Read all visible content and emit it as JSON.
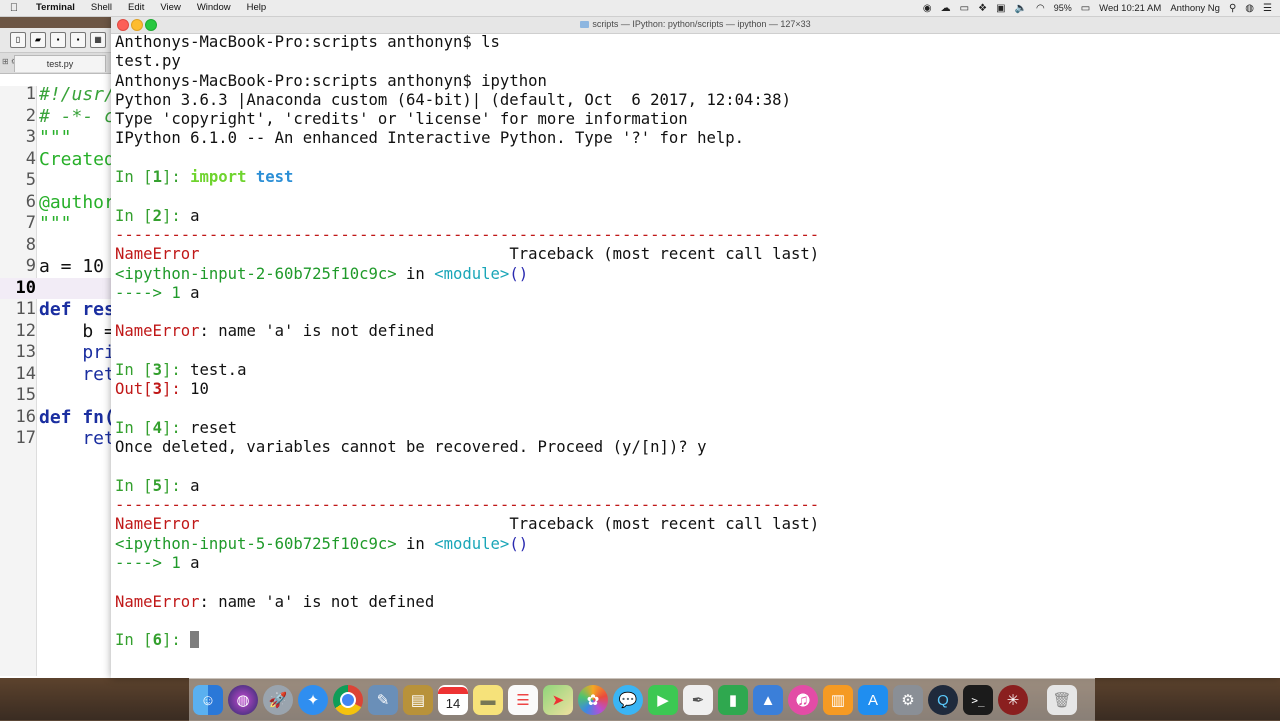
{
  "menubar": {
    "items": [
      "Terminal",
      "Shell",
      "Edit",
      "View",
      "Window",
      "Help"
    ],
    "battery": "95%",
    "clock": "Wed 10:21 AM",
    "user": "Anthony Ng"
  },
  "editor": {
    "tab_label": "test.py",
    "lines": [
      {
        "n": "1",
        "text": "#!/usr/"
      },
      {
        "n": "2",
        "text": "# -*- c"
      },
      {
        "n": "3",
        "text": "\"\"\""
      },
      {
        "n": "4",
        "text": "Created"
      },
      {
        "n": "5",
        "text": ""
      },
      {
        "n": "6",
        "text": "@author"
      },
      {
        "n": "7",
        "text": "\"\"\""
      },
      {
        "n": "8",
        "text": ""
      },
      {
        "n": "9",
        "text": "a = 10"
      },
      {
        "n": "10",
        "text": ""
      },
      {
        "n": "11",
        "text": "def res"
      },
      {
        "n": "12",
        "text": "    b ="
      },
      {
        "n": "13",
        "text": "    pri"
      },
      {
        "n": "14",
        "text": "    ret"
      },
      {
        "n": "15",
        "text": ""
      },
      {
        "n": "16",
        "text": "def fn("
      },
      {
        "n": "17",
        "text": "    ret"
      }
    ]
  },
  "terminal": {
    "title": "scripts — IPython: python/scripts — ipython — 127×33",
    "prompt_host": "Anthonys-MacBook-Pro:scripts anthonyn$",
    "cmd_ls": "ls",
    "ls_output": "test.py",
    "cmd_ipython": "ipython",
    "banner1": "Python 3.6.3 |Anaconda custom (64-bit)| (default, Oct  6 2017, 12:04:38)",
    "banner2": "Type 'copyright', 'credits' or 'license' for more information",
    "banner3": "IPython 6.1.0 -- An enhanced Interactive Python. Type '?' for help.",
    "in1_label": "In [",
    "in1_num": "1",
    "in_close": "]: ",
    "in1_kw": "import",
    "in1_mod": "test",
    "in2_num": "2",
    "in2_code": "a",
    "dashes": "---------------------------------------------------------------------------",
    "err_name": "NameError",
    "tb_gap": "                                 ",
    "tb_text": "Traceback (most recent call last)",
    "tb2_loc": "<ipython-input-2-60b725f10c9c>",
    "tb_in": " in ",
    "tb_module": "<module>",
    "tb_parens": "()",
    "arrow": "----> 1 ",
    "arrow_code": "a",
    "err_msg": ": name 'a' is not defined",
    "in3_num": "3",
    "in3_code": "test.a",
    "out_label": "Out[",
    "out3_num": "3",
    "out_close": "]: ",
    "out3_val": "10",
    "in4_num": "4",
    "in4_code": "reset",
    "reset_msg": "Once deleted, variables cannot be recovered. Proceed (y/[n])? y",
    "in5_num": "5",
    "in5_code": "a",
    "tb5_loc": "<ipython-input-5-60b725f10c9c>",
    "in6_num": "6"
  },
  "dock": {
    "calendar_day": "14",
    "icons": [
      "finder-icon",
      "siri-icon",
      "launchpad-icon",
      "safari-icon",
      "chrome-icon",
      "preview-icon",
      "notes-icon",
      "stickies-icon",
      "reminders-icon",
      "maps-icon",
      "photos-icon",
      "messages-icon",
      "facetime-icon",
      "textedit-icon",
      "numbers-icon",
      "keynote-icon",
      "itunes-icon",
      "ibooks-icon",
      "appstore-icon",
      "system-preferences-icon",
      "quicktime-icon",
      "terminal-icon",
      "spyder-icon",
      "trash-icon"
    ]
  },
  "colors": {
    "prompt_green": "#34a02e",
    "error_red": "#c01818",
    "keyword_lime": "#6fd42e",
    "module_blue": "#2c8fd6"
  }
}
